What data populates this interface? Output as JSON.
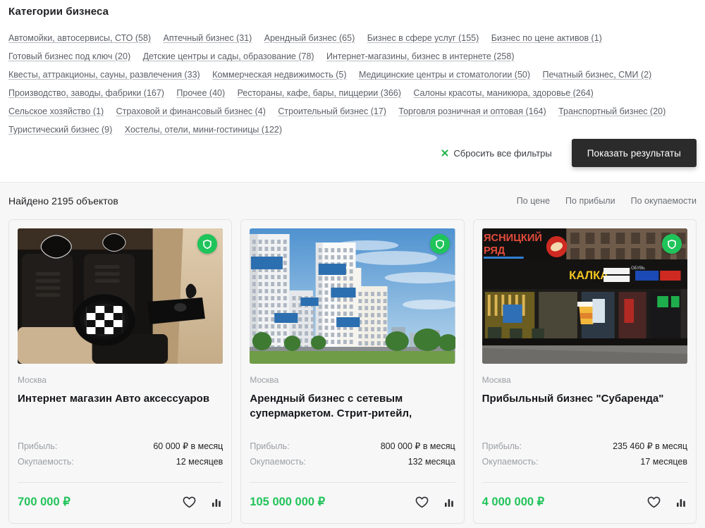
{
  "categories": {
    "title": "Категории бизнеса",
    "items": [
      "Автомойки, автосервисы, СТО (58)",
      "Аптечный бизнес (31)",
      "Арендный бизнес (65)",
      "Бизнес в сфере услуг (155)",
      "Бизнес по цене активов (1)",
      "Готовый бизнес под ключ (20)",
      "Детские центры и сады, образование (78)",
      "Интернет-магазины, бизнес в интернете (258)",
      "Квесты, аттракционы, сауны, развлечения (33)",
      "Коммерческая недвижимость (5)",
      "Медицинские центры и стоматологии (50)",
      "Печатный бизнес, СМИ (2)",
      "Производство, заводы, фабрики (167)",
      "Прочее (40)",
      "Рестораны, кафе, бары, пиццерии (366)",
      "Салоны красоты, маникюра, здоровье (264)",
      "Сельское хозяйство (1)",
      "Страховой и финансовый бизнес (4)",
      "Строительный бизнес (17)",
      "Торговля розничная и оптовая (164)",
      "Транспортный бизнес (20)",
      "Туристический бизнес (9)",
      "Хостелы, отели, мини-гостиницы (122)"
    ]
  },
  "filters": {
    "reset_label": "Сбросить все фильтры",
    "reset_icon": "close-x-icon",
    "show_results_label": "Показать результаты"
  },
  "results": {
    "count_label": "Найдено 2195 объектов",
    "sorts": [
      {
        "label": "По цене"
      },
      {
        "label": "По прибыли"
      },
      {
        "label": "По окупаемости"
      }
    ]
  },
  "cards": [
    {
      "image": "car-interior-seat-covers",
      "verified_icon": "shield-check-icon",
      "city": "Москва",
      "title": "Интернет магазин Авто аксессуаров",
      "profit_label": "Прибыль:",
      "profit_value": "60 000 ₽ в месяц",
      "payback_label": "Окупаемость:",
      "payback_value": "12 месяцев",
      "price": "700 000 ₽",
      "favorite_icon": "heart-icon",
      "compare_icon": "bar-chart-icon"
    },
    {
      "image": "residential-buildings",
      "verified_icon": "shield-check-icon",
      "city": "Москва",
      "title": "Арендный бизнес с сетевым супермаркетом. Стрит-ритейл,",
      "profit_label": "Прибыль:",
      "profit_value": "800 000 ₽ в месяц",
      "payback_label": "Окупаемость:",
      "payback_value": "132 месяца",
      "price": "105 000 000 ₽",
      "favorite_icon": "heart-icon",
      "compare_icon": "bar-chart-icon"
    },
    {
      "image": "street-retail-storefront",
      "verified_icon": "shield-check-icon",
      "city": "Москва",
      "title": "Прибыльный бизнес \"Субаренда\"",
      "profit_label": "Прибыль:",
      "profit_value": "235 460 ₽ в месяц",
      "payback_label": "Окупаемость:",
      "payback_value": "17 месяцев",
      "price": "4 000 000 ₽",
      "favorite_icon": "heart-icon",
      "compare_icon": "bar-chart-icon"
    }
  ],
  "colors": {
    "accent_green": "#22c35a",
    "badge_green": "#1fc45a",
    "button_dark": "#2b2b2b",
    "muted_text": "#9a9ea4",
    "page_bg": "#f7f7f7"
  }
}
